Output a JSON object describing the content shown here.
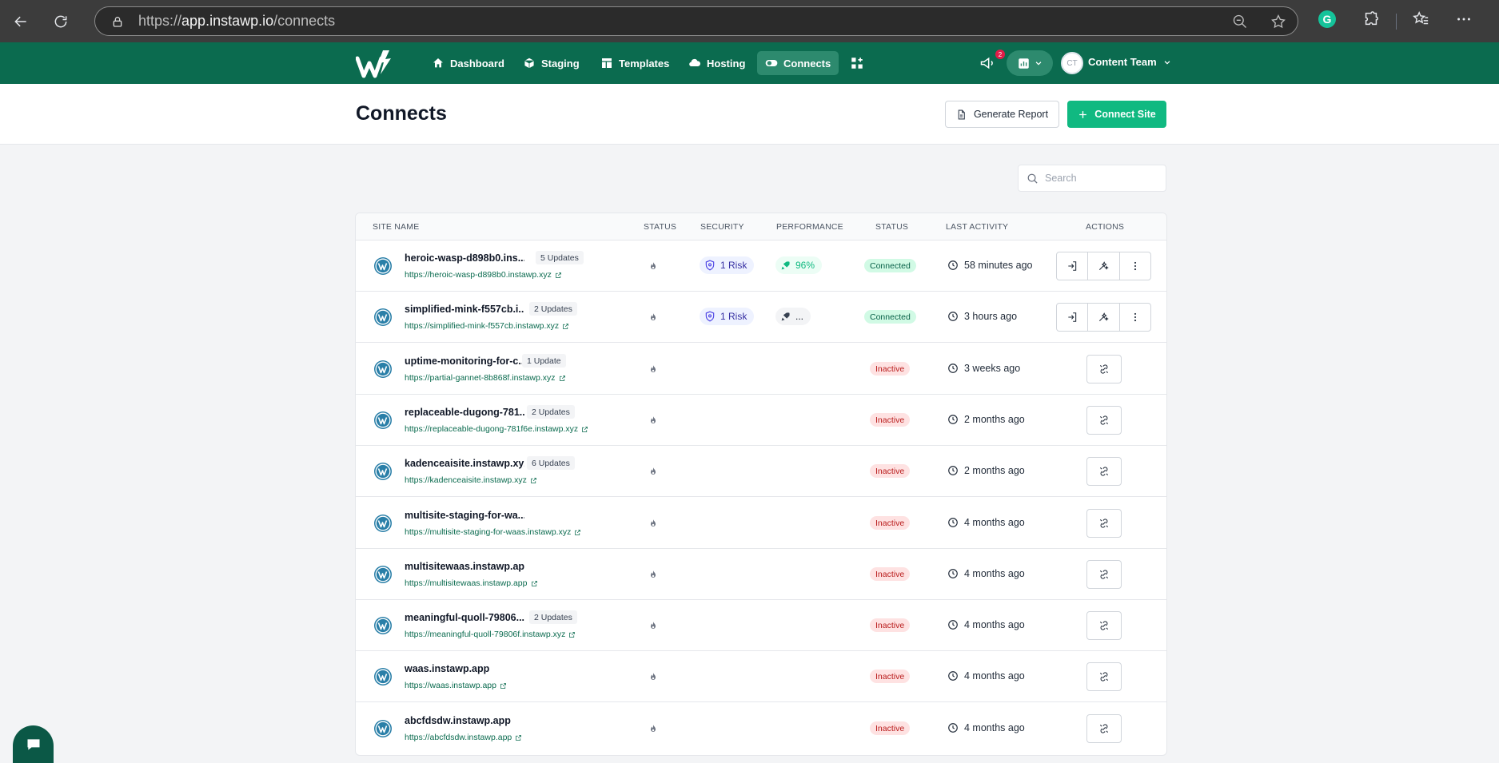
{
  "browser": {
    "url_prefix": "https://",
    "url_host": "app.instawp.io",
    "url_path": "/connects"
  },
  "nav": {
    "items": [
      {
        "label": "Dashboard",
        "icon": "home-icon"
      },
      {
        "label": "Staging",
        "icon": "cube-icon"
      },
      {
        "label": "Templates",
        "icon": "template-icon"
      },
      {
        "label": "Hosting",
        "icon": "cloud-icon"
      },
      {
        "label": "Connects",
        "icon": "toggle-icon",
        "active": true
      }
    ],
    "notification_count": "2",
    "avatar_initials": "CT",
    "team": "Content Team"
  },
  "page": {
    "title": "Connects",
    "generate_report": "Generate Report",
    "connect_site": "Connect Site",
    "search_placeholder": "Search"
  },
  "table": {
    "headers": {
      "site_name": "SITE NAME",
      "status": "STATUS",
      "security": "SECURITY",
      "performance": "PERFORMANCE",
      "status2": "STATUS",
      "last_activity": "LAST ACTIVITY",
      "actions": "ACTIONS"
    },
    "rows": [
      {
        "name": "heroic-wasp-d898b0.ins...",
        "updates": "5 Updates",
        "url": "https://heroic-wasp-d898b0.instawp.xyz",
        "security": "1 Risk",
        "performance": "96%",
        "state": "Connected",
        "activity": "58 minutes ago"
      },
      {
        "name": "simplified-mink-f557cb.i...",
        "updates": "2 Updates",
        "url": "https://simplified-mink-f557cb.instawp.xyz",
        "security": "1 Risk",
        "performance": "...",
        "state": "Connected",
        "activity": "3 hours ago"
      },
      {
        "name": "uptime-monitoring-for-c...",
        "updates": "1 Update",
        "url": "https://partial-gannet-8b868f.instawp.xyz",
        "state": "Inactive",
        "activity": "3 weeks ago"
      },
      {
        "name": "replaceable-dugong-781...",
        "updates": "2 Updates",
        "url": "https://replaceable-dugong-781f6e.instawp.xyz",
        "state": "Inactive",
        "activity": "2 months ago"
      },
      {
        "name": "kadenceaisite.instawp.xyz",
        "updates": "6 Updates",
        "url": "https://kadenceaisite.instawp.xyz",
        "state": "Inactive",
        "activity": "2 months ago"
      },
      {
        "name": "multisite-staging-for-wa...",
        "url": "https://multisite-staging-for-waas.instawp.xyz",
        "state": "Inactive",
        "activity": "4 months ago"
      },
      {
        "name": "multisitewaas.instawp.app",
        "url": "https://multisitewaas.instawp.app",
        "state": "Inactive",
        "activity": "4 months ago"
      },
      {
        "name": "meaningful-quoll-79806...",
        "updates": "2 Updates",
        "url": "https://meaningful-quoll-79806f.instawp.xyz",
        "state": "Inactive",
        "activity": "4 months ago"
      },
      {
        "name": "waas.instawp.app",
        "url": "https://waas.instawp.app",
        "state": "Inactive",
        "activity": "4 months ago"
      },
      {
        "name": "abcfdsdw.instawp.app",
        "url": "https://abcfdsdw.instawp.app",
        "state": "Inactive",
        "activity": "4 months ago"
      }
    ]
  },
  "colors": {
    "brand": "#0b6b4f",
    "accent": "#10b981",
    "inactive": "#b91c1c"
  }
}
